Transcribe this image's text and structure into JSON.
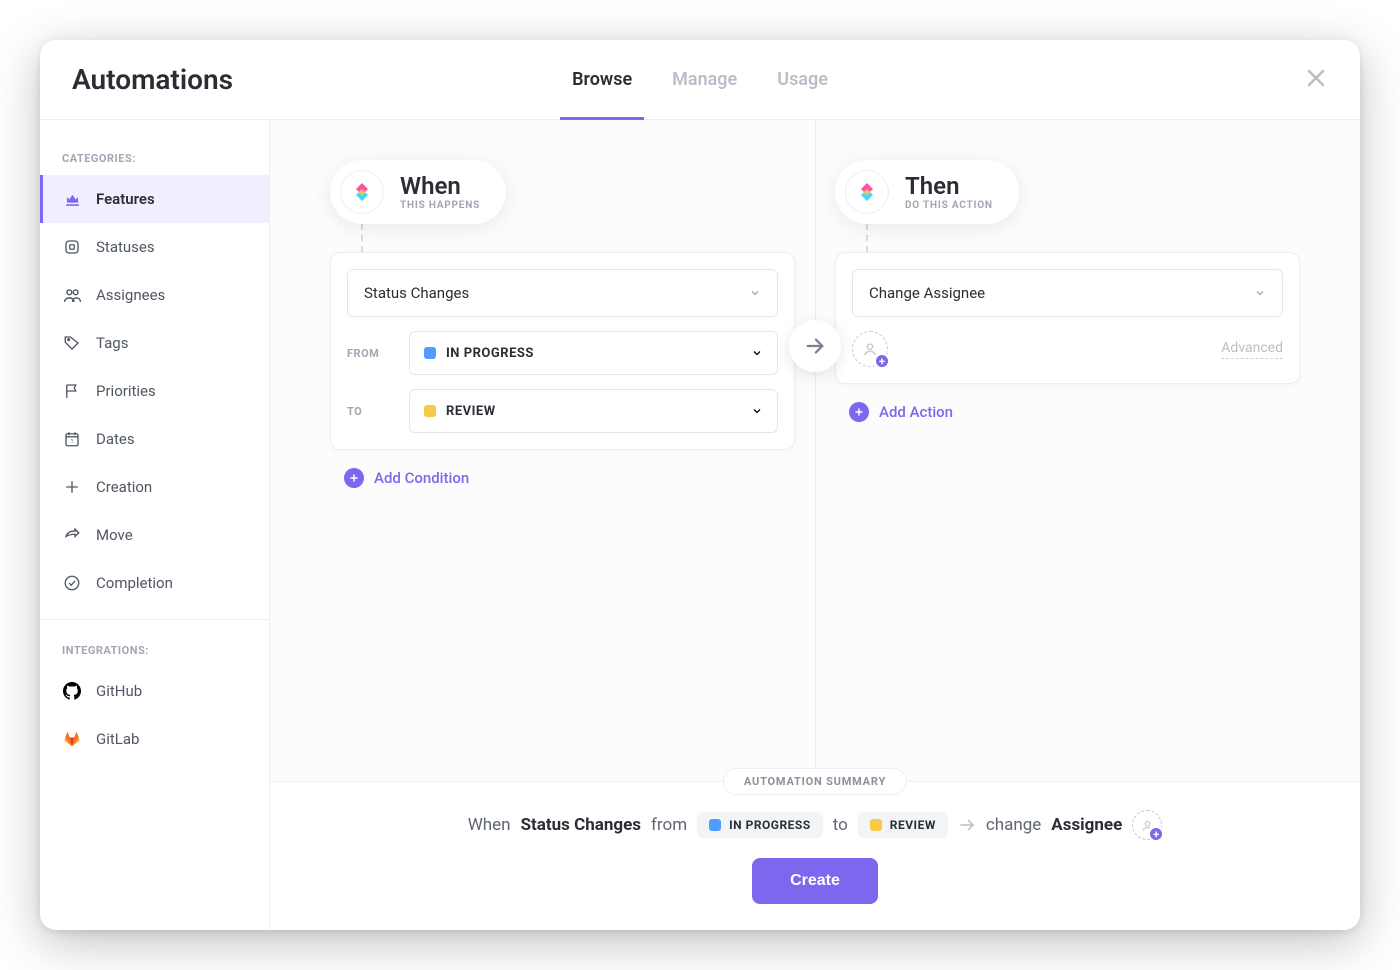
{
  "header": {
    "title": "Automations",
    "tabs": [
      {
        "label": "Browse",
        "active": true
      },
      {
        "label": "Manage",
        "active": false
      },
      {
        "label": "Usage",
        "active": false
      }
    ]
  },
  "sidebar": {
    "categories_label": "CATEGORIES:",
    "integrations_label": "INTEGRATIONS:",
    "categories": [
      {
        "label": "Features",
        "icon": "crown-icon",
        "active": true
      },
      {
        "label": "Statuses",
        "icon": "square-icon",
        "active": false
      },
      {
        "label": "Assignees",
        "icon": "users-icon",
        "active": false
      },
      {
        "label": "Tags",
        "icon": "tag-icon",
        "active": false
      },
      {
        "label": "Priorities",
        "icon": "flag-icon",
        "active": false
      },
      {
        "label": "Dates",
        "icon": "calendar-icon",
        "active": false
      },
      {
        "label": "Creation",
        "icon": "plus-icon",
        "active": false
      },
      {
        "label": "Move",
        "icon": "share-icon",
        "active": false
      },
      {
        "label": "Completion",
        "icon": "check-circle-icon",
        "active": false
      }
    ],
    "integrations": [
      {
        "label": "GitHub",
        "icon": "github-icon"
      },
      {
        "label": "GitLab",
        "icon": "gitlab-icon"
      }
    ]
  },
  "when": {
    "title": "When",
    "subtitle": "THIS HAPPENS",
    "trigger_label": "Status Changes",
    "from_label": "FROM",
    "to_label": "TO",
    "from_status": {
      "name": "IN PROGRESS",
      "color": "#4e9cff"
    },
    "to_status": {
      "name": "REVIEW",
      "color": "#f7c948"
    },
    "add_condition_label": "Add Condition"
  },
  "then": {
    "title": "Then",
    "subtitle": "DO THIS ACTION",
    "action_label": "Change Assignee",
    "advanced_label": "Advanced",
    "add_action_label": "Add Action"
  },
  "summary": {
    "badge": "AUTOMATION SUMMARY",
    "prefix": "When",
    "trigger": "Status Changes",
    "from_word": "from",
    "to_word": "to",
    "from_status": {
      "name": "IN PROGRESS",
      "color": "#4e9cff"
    },
    "to_status": {
      "name": "REVIEW",
      "color": "#f7c948"
    },
    "action_prefix": "change",
    "action_target": "Assignee",
    "create_label": "Create"
  }
}
